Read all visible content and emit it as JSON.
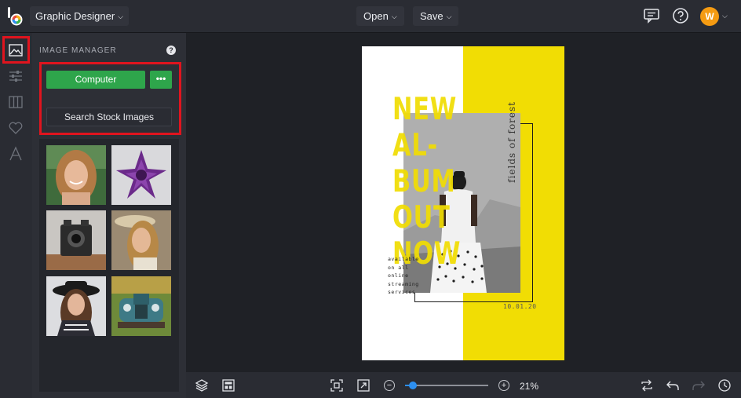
{
  "topbar": {
    "app_name": "Graphic Designer",
    "open_label": "Open",
    "save_label": "Save",
    "avatar_initial": "W"
  },
  "panel": {
    "title": "IMAGE MANAGER",
    "help_glyph": "?",
    "computer_label": "Computer",
    "more_label": "•••",
    "stock_label": "Search Stock Images",
    "thumbnails": [
      "portrait-woman-smiling",
      "purple-succulent",
      "vintage-camera",
      "woman-with-hat",
      "woman-black-hat",
      "vintage-blue-truck"
    ]
  },
  "design": {
    "headline": [
      "NEW",
      "AL-",
      "BUM",
      "OUT",
      "NOW"
    ],
    "side_text": "fields of forest",
    "small_lines": [
      "available",
      "on all",
      "online",
      "streaming",
      "services"
    ],
    "date": "10.01.20"
  },
  "bottombar": {
    "zoom_minus": "−",
    "zoom_plus": "+",
    "zoom_value": "21%",
    "zoom_level": 0.21
  },
  "colors": {
    "accent_green": "#2ea54b",
    "highlight_red": "#e0141e",
    "design_yellow": "#f1dd04",
    "avatar_orange": "#f59b12",
    "slider_blue": "#2d8ff0"
  }
}
